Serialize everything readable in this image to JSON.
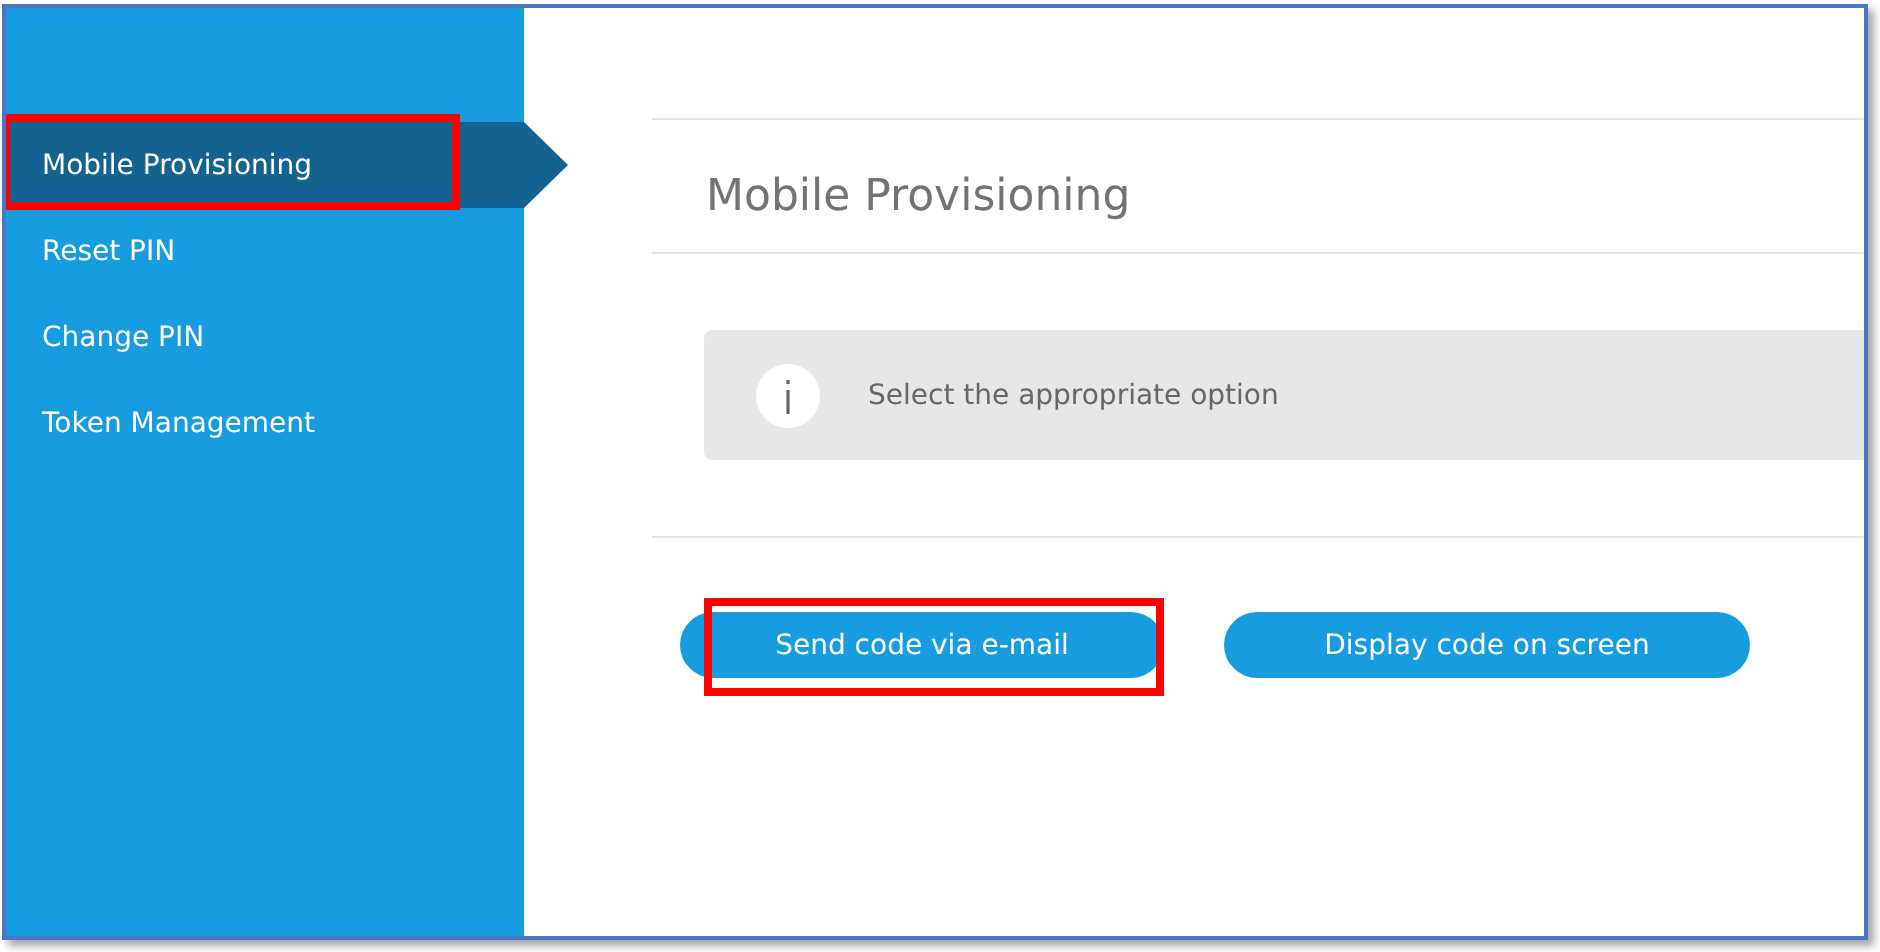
{
  "sidebar": {
    "items": [
      {
        "label": "Mobile Provisioning",
        "selected": true,
        "highlighted": true
      },
      {
        "label": "Reset PIN",
        "selected": false,
        "highlighted": false
      },
      {
        "label": "Change PIN",
        "selected": false,
        "highlighted": false
      },
      {
        "label": "Token Management",
        "selected": false,
        "highlighted": false
      }
    ]
  },
  "page": {
    "title": "Mobile Provisioning",
    "info": "Select the appropriate option"
  },
  "buttons": [
    {
      "label": "Send code via e-mail",
      "highlighted": true
    },
    {
      "label": "Display code on screen",
      "highlighted": false
    }
  ]
}
